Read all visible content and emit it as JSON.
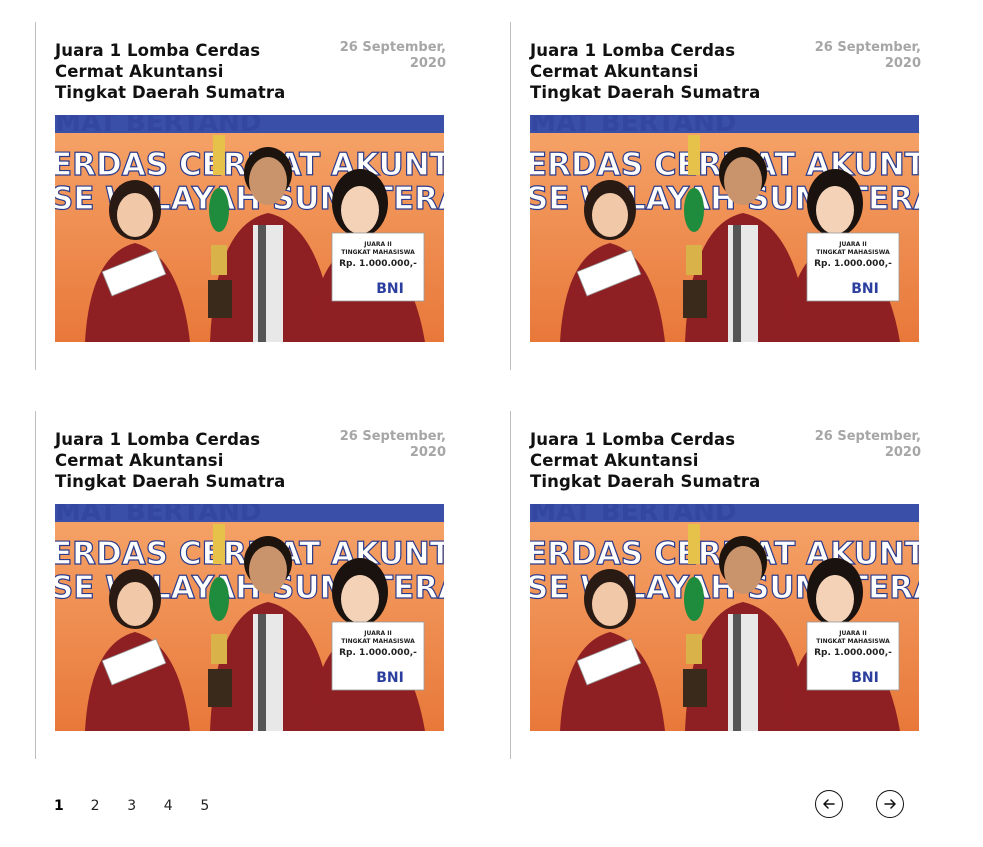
{
  "articles": [
    {
      "title_lines": [
        "Juara 1 Lomba Cerdas",
        "Cermat Akuntansi",
        "Tingkat Daerah Sumatra"
      ],
      "date_lines": [
        "26 September,",
        "2020"
      ]
    },
    {
      "title_lines": [
        "Juara 1 Lomba Cerdas",
        "Cermat Akuntansi",
        "Tingkat Daerah Sumatra"
      ],
      "date_lines": [
        "26 September,",
        "2020"
      ]
    },
    {
      "title_lines": [
        "Juara 1 Lomba Cerdas",
        "Cermat Akuntansi",
        "Tingkat Daerah Sumatra"
      ],
      "date_lines": [
        "26 September,",
        "2020"
      ]
    },
    {
      "title_lines": [
        "Juara 1 Lomba Cerdas",
        "Cermat Akuntansi",
        "Tingkat Daerah Sumatra"
      ],
      "date_lines": [
        "26 September,",
        "2020"
      ]
    }
  ],
  "photo": {
    "banner_top": "AMAT BERTAND",
    "banner_line1": "ERDAS CERMAT AKUNTA",
    "banner_line2": "SE WILAYAH SUMATERA",
    "card_title": "JUARA II",
    "card_subtitle": "TINGKAT MAHASISWA",
    "card_amount": "Rp. 1.000.000,-",
    "card_bank": "BNI"
  },
  "pagination": {
    "pages": [
      "1",
      "2",
      "3",
      "4",
      "5"
    ],
    "active": "1"
  },
  "colors": {
    "title": "#111111",
    "date": "#a6a6a6",
    "divider": "#bdbdbd",
    "banner_bg": "#f28a45",
    "jacket": "#8e1f22"
  },
  "icons": {
    "prev": "arrow-left-circle-icon",
    "next": "arrow-right-circle-icon"
  }
}
